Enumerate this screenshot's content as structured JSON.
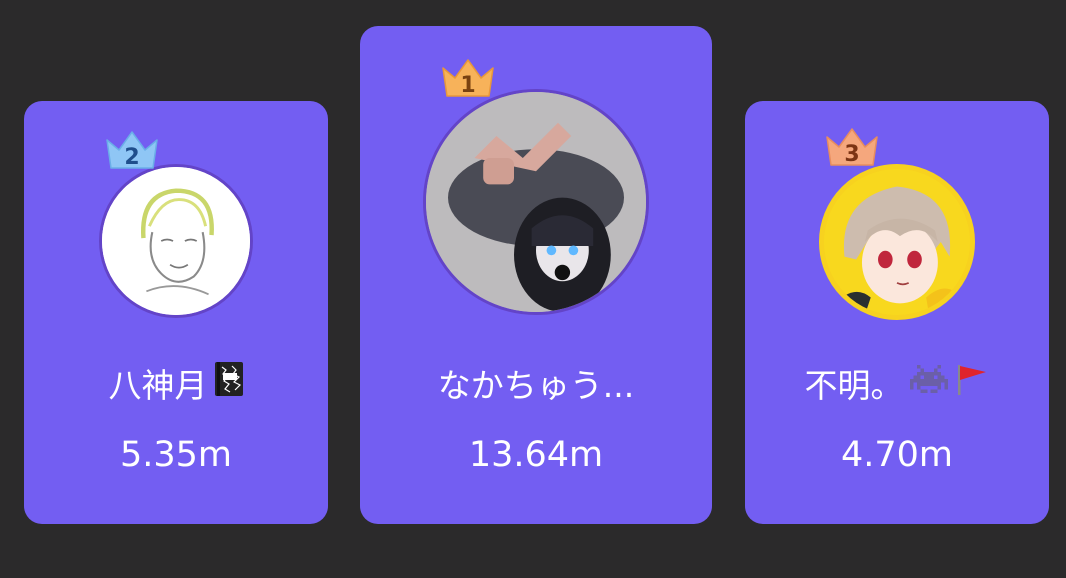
{
  "leaderboard": {
    "entries": [
      {
        "rank": "2",
        "name": "八神月",
        "emoji_icons": [
          "composition-notebook-icon"
        ],
        "score": "5.35m",
        "avatar": "sketch-avatar",
        "crown_color": "#8fc6f5"
      },
      {
        "rank": "1",
        "name": "なかちゅう...",
        "emoji_icons": [],
        "score": "13.64m",
        "avatar": "photo-avatar",
        "crown_color": "#f7b25a"
      },
      {
        "rank": "3",
        "name": "不明。",
        "emoji_icons": [
          "space-invader-icon",
          "red-flag-icon"
        ],
        "score": "4.70m",
        "avatar": "anime-avatar",
        "crown_color": "#f5a77d"
      }
    ]
  },
  "colors": {
    "background": "#2b2a2b",
    "card": "#735ef2",
    "text": "#ffffff"
  }
}
